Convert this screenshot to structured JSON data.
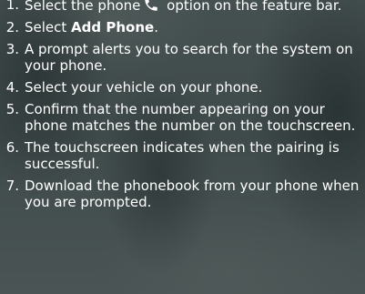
{
  "steps": [
    {
      "number": "1.",
      "text_before": "Select the phone",
      "icon": "phone-icon",
      "text_after": "option on the feature bar."
    },
    {
      "number": "2.",
      "text_before": "Select ",
      "bold": "Add Phone",
      "text_after": "."
    },
    {
      "number": "3.",
      "text": "A prompt alerts you to search for the system on your phone."
    },
    {
      "number": "4.",
      "text": "Select your vehicle on your phone."
    },
    {
      "number": "5.",
      "text": "Confirm that the number appearing on your phone matches the number on the touchscreen."
    },
    {
      "number": "6.",
      "text": "The touchscreen indicates when the pairing is successful."
    },
    {
      "number": "7.",
      "text": "Download the phonebook from your phone when you are prompted."
    }
  ],
  "colors": {
    "text": "#ffffff",
    "background": "#3f4a4a"
  }
}
